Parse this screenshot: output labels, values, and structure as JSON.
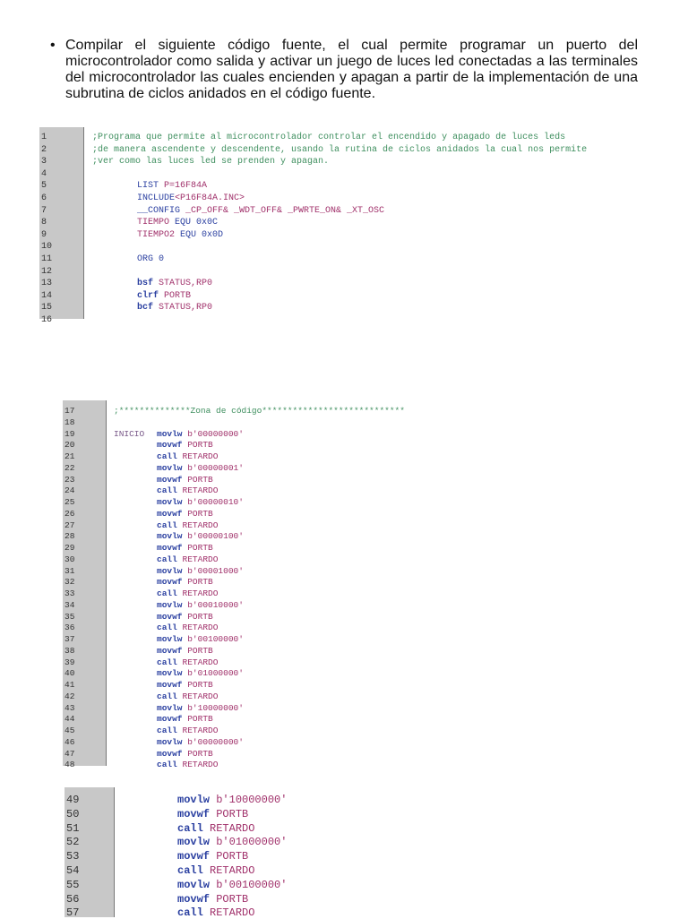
{
  "intro": {
    "bullet": "•",
    "text": "Compilar el siguiente código fuente, el cual permite programar un puerto del microcontrolador como salida y activar un juego de luces led conectadas a las terminales del microcontrolador las cuales encienden y apagan a partir de la implementación de una subrutina de ciclos anidados en el código fuente."
  },
  "blocks": [
    {
      "lines": [
        {
          "n": "1",
          "cmt": ";Programa que permite al microcontrolador controlar el encendido y apagado de luces leds"
        },
        {
          "n": "2",
          "cmt": ";de manera ascendente y descendente, usando la rutina de ciclos anidados la cual nos permite"
        },
        {
          "n": "3",
          "cmt": ";ver como las luces led se prenden y apagan."
        },
        {
          "n": "4"
        },
        {
          "n": "5",
          "kw": "LIST ",
          "arg": "P=16F84A"
        },
        {
          "n": "6",
          "kw": "INCLUDE",
          "arg": "<P16F84A.INC>"
        },
        {
          "n": "7",
          "kw": "__CONFIG ",
          "arg": "_CP_OFF& _WDT_OFF& _PWRTE_ON& _XT_OSC"
        },
        {
          "n": "8",
          "arg": "TIEMPO ",
          "kw": "EQU 0x0C"
        },
        {
          "n": "9",
          "arg": "TIEMPO2 ",
          "kw": "EQU 0x0D"
        },
        {
          "n": "10"
        },
        {
          "n": "11",
          "kw": "ORG 0"
        },
        {
          "n": "12"
        },
        {
          "n": "13",
          "op": "bsf ",
          "arg": "STATUS,RP0"
        },
        {
          "n": "14",
          "op": "clrf ",
          "arg": "PORTB"
        },
        {
          "n": "15",
          "op": "bcf ",
          "arg": "STATUS,RP0"
        },
        {
          "n": "16"
        }
      ]
    },
    {
      "lines": [
        {
          "n": "17",
          "cmt": ";**************Zona de código****************************"
        },
        {
          "n": "18"
        },
        {
          "n": "19",
          "lbl": "INICIO",
          "op": "movlw ",
          "arg": "b'00000000'"
        },
        {
          "n": "20",
          "op": "movwf ",
          "arg": "PORTB"
        },
        {
          "n": "21",
          "op": "call ",
          "arg": "RETARDO"
        },
        {
          "n": "22",
          "op": "movlw ",
          "arg": "b'00000001'"
        },
        {
          "n": "23",
          "op": "movwf ",
          "arg": "PORTB"
        },
        {
          "n": "24",
          "op": "call ",
          "arg": "RETARDO"
        },
        {
          "n": "25",
          "op": "movlw ",
          "arg": "b'00000010'"
        },
        {
          "n": "26",
          "op": "movwf ",
          "arg": "PORTB"
        },
        {
          "n": "27",
          "op": "call ",
          "arg": "RETARDO"
        },
        {
          "n": "28",
          "op": "movlw ",
          "arg": "b'00000100'"
        },
        {
          "n": "29",
          "op": "movwf ",
          "arg": "PORTB"
        },
        {
          "n": "30",
          "op": "call ",
          "arg": "RETARDO"
        },
        {
          "n": "31",
          "op": "movlw ",
          "arg": "b'00001000'"
        },
        {
          "n": "32",
          "op": "movwf ",
          "arg": "PORTB"
        },
        {
          "n": "33",
          "op": "call ",
          "arg": "RETARDO"
        },
        {
          "n": "34",
          "op": "movlw ",
          "arg": "b'00010000'"
        },
        {
          "n": "35",
          "op": "movwf ",
          "arg": "PORTB"
        },
        {
          "n": "36",
          "op": "call ",
          "arg": "RETARDO"
        },
        {
          "n": "37",
          "op": "movlw ",
          "arg": "b'00100000'"
        },
        {
          "n": "38",
          "op": "movwf ",
          "arg": "PORTB"
        },
        {
          "n": "39",
          "op": "call ",
          "arg": "RETARDO"
        },
        {
          "n": "40",
          "op": "movlw ",
          "arg": "b'01000000'"
        },
        {
          "n": "41",
          "op": "movwf ",
          "arg": "PORTB"
        },
        {
          "n": "42",
          "op": "call ",
          "arg": "RETARDO"
        },
        {
          "n": "43",
          "op": "movlw ",
          "arg": "b'10000000'"
        },
        {
          "n": "44",
          "op": "movwf ",
          "arg": "PORTB"
        },
        {
          "n": "45",
          "op": "call ",
          "arg": "RETARDO"
        },
        {
          "n": "46",
          "op": "movlw ",
          "arg": "b'00000000'"
        },
        {
          "n": "47",
          "op": "movwf ",
          "arg": "PORTB"
        },
        {
          "n": "48",
          "op": "call ",
          "arg": "RETARDO"
        }
      ]
    },
    {
      "lines": [
        {
          "n": "49",
          "op": "movlw ",
          "arg": "b'10000000'"
        },
        {
          "n": "50",
          "op": "movwf ",
          "arg": "PORTB"
        },
        {
          "n": "51",
          "op": "call ",
          "arg": "RETARDO"
        },
        {
          "n": "52",
          "op": "movlw ",
          "arg": "b'01000000'"
        },
        {
          "n": "53",
          "op": "movwf ",
          "arg": "PORTB"
        },
        {
          "n": "54",
          "op": "call ",
          "arg": "RETARDO"
        },
        {
          "n": "55",
          "op": "movlw ",
          "arg": "b'00100000'"
        },
        {
          "n": "56",
          "op": "movwf ",
          "arg": "PORTB"
        },
        {
          "n": "57",
          "op": "call ",
          "arg": "RETARDO"
        }
      ]
    }
  ]
}
